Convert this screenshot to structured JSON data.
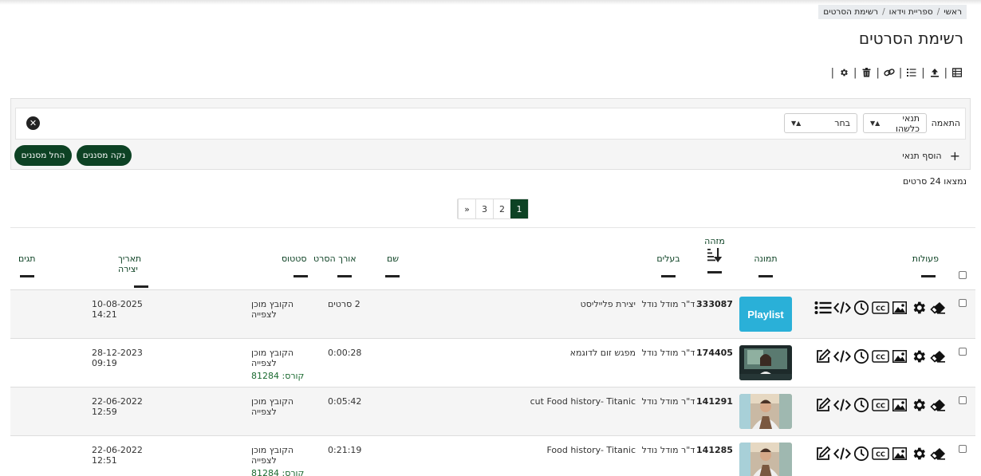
{
  "breadcrumb": [
    "ראשי",
    "ספריית וידאו",
    "רשימת הסרטים"
  ],
  "page_title": "רשימת הסרטים",
  "toolbar_icons": [
    "table-icon",
    "upload-icon",
    "list-icon",
    "link-icon",
    "trash-icon",
    "gear-icon"
  ],
  "filter": {
    "match_label": "התאמה",
    "condition_select": "תנאי כלשהו",
    "field_select": "בחר",
    "add_condition": "הוסף תנאי",
    "clear_button": "נקה מסננים",
    "apply_button": "החל מסננים"
  },
  "found_text": "נמצאו 24 סרטים",
  "pagination": {
    "pages": [
      "1",
      "2",
      "3"
    ],
    "next": "»",
    "active": "1"
  },
  "columns": {
    "actions": "פעולות",
    "image": "תמונה",
    "id": "מזהה",
    "owner": "בעלים",
    "name": "שם",
    "duration": "אורך הסרט",
    "status": "סטטוס",
    "created": "תאריך יצירה",
    "tags": "תגים"
  },
  "rows": [
    {
      "id": "333087",
      "owner": "ד\"ר מודל נודל",
      "name": "יצירת פלייליסט",
      "duration": "2 סרטים",
      "status": "הקובץ מוכן לצפייה",
      "course": "",
      "created": "10-08-2025 14:21",
      "thumb_label": "Playlist",
      "thumb_type": "playlist"
    },
    {
      "id": "174405",
      "owner": "ד\"ר מודל נודל",
      "name": "מפגש זום לדוגמא",
      "duration": "0:00:28",
      "status": "הקובץ מוכן לצפייה",
      "course": "קורס: 81284",
      "created": "28-12-2023 09:19",
      "thumb_label": "",
      "thumb_type": "zoom"
    },
    {
      "id": "141291",
      "owner": "ד\"ר מודל נודל",
      "name": "cut Food history- Titanic",
      "duration": "0:05:42",
      "status": "הקובץ מוכן לצפייה",
      "course": "",
      "created": "22-06-2022 12:59",
      "thumb_label": "",
      "thumb_type": "chef"
    },
    {
      "id": "141285",
      "owner": "ד\"ר מודל נודל",
      "name": "Food history- Titanic",
      "duration": "0:21:19",
      "status": "הקובץ מוכן לצפייה",
      "course": "קורס: 81284",
      "created": "22-06-2022 12:51",
      "thumb_label": "",
      "thumb_type": "chef"
    }
  ]
}
